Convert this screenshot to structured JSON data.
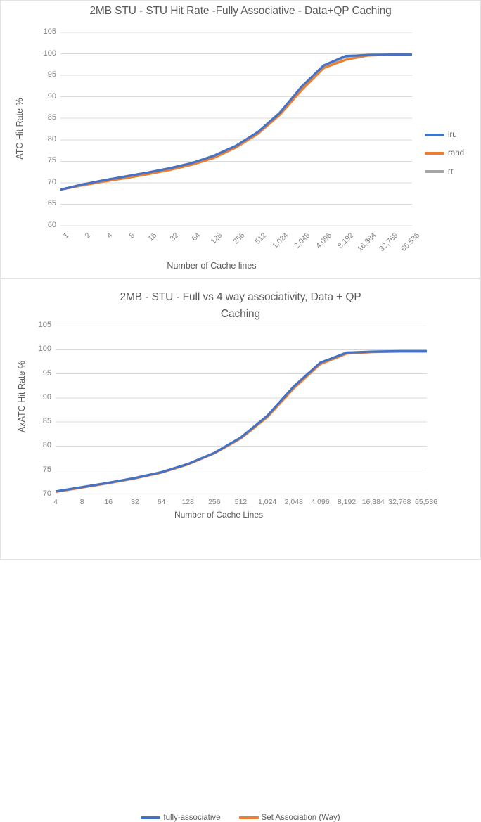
{
  "chart_data": [
    {
      "type": "line",
      "title": "2MB STU - STU Hit Rate -Fully Associative - Data+QP Caching",
      "xlabel": "Number of Cache lines",
      "ylabel": "ATC Hit Rate %",
      "ylim": [
        60,
        105
      ],
      "yticks": [
        60,
        65,
        70,
        75,
        80,
        85,
        90,
        95,
        100,
        105
      ],
      "grid": true,
      "legend_position": "right",
      "categories": [
        "1",
        "2",
        "4",
        "8",
        "16",
        "32",
        "64",
        "128",
        "256",
        "512",
        "1,024",
        "2,048",
        "4,096",
        "8,192",
        "16,384",
        "32,768",
        "65,536"
      ],
      "series": [
        {
          "name": "lru",
          "color": "#4472C4",
          "values": [
            68.4,
            69.6,
            70.6,
            71.5,
            72.4,
            73.4,
            74.6,
            76.3,
            78.6,
            81.8,
            86.3,
            92.4,
            97.3,
            99.5,
            99.7,
            99.8,
            99.8
          ]
        },
        {
          "name": "rand",
          "color": "#ED7D31",
          "values": [
            68.4,
            69.4,
            70.3,
            71.1,
            72.0,
            73.0,
            74.2,
            75.8,
            78.2,
            81.4,
            85.8,
            91.6,
            96.7,
            98.6,
            99.6,
            99.8,
            99.8
          ]
        },
        {
          "name": "rr",
          "color": "#A5A5A5",
          "values": [
            68.4,
            69.5,
            70.5,
            71.3,
            72.2,
            73.2,
            74.4,
            76.0,
            78.4,
            81.6,
            86.0,
            92.0,
            97.0,
            99.3,
            99.8,
            99.8,
            99.8
          ]
        }
      ]
    },
    {
      "type": "line",
      "title_line1": "2MB - STU - Full vs 4 way associativity, Data + QP",
      "title_line2": "Caching",
      "title": "2MB - STU - Full vs 4 way associativity, Data + QP Caching",
      "xlabel": "Number of Cache Lines",
      "ylabel": "AxATC Hit Rate %",
      "ylim": [
        70,
        105
      ],
      "yticks": [
        70,
        75,
        80,
        85,
        90,
        95,
        100,
        105
      ],
      "grid": true,
      "legend_position": "bottom",
      "categories": [
        "4",
        "8",
        "16",
        "32",
        "64",
        "128",
        "256",
        "512",
        "1,024",
        "2,048",
        "4,096",
        "8,192",
        "16,384",
        "32,768",
        "65,536"
      ],
      "series": [
        {
          "name": "fully-associative",
          "color": "#4472C4",
          "values": [
            70.6,
            71.5,
            72.4,
            73.4,
            74.6,
            76.3,
            78.6,
            81.8,
            86.3,
            92.4,
            97.3,
            99.4,
            99.6,
            99.7,
            99.7
          ]
        },
        {
          "name": "Set Association (Way)",
          "color": "#ED7D31",
          "values": [
            70.5,
            71.4,
            72.3,
            73.3,
            74.5,
            76.2,
            78.5,
            81.6,
            86.0,
            92.0,
            97.0,
            99.2,
            99.5,
            99.6,
            99.6
          ]
        }
      ]
    }
  ],
  "chart1": {
    "title": "2MB STU - STU Hit Rate -Fully Associative - Data+QP Caching",
    "ylabel": "ATC Hit Rate %",
    "xlabel": "Number of Cache lines",
    "legend": [
      {
        "label": "lru",
        "color": "#4472C4"
      },
      {
        "label": "rand",
        "color": "#ED7D31"
      },
      {
        "label": "rr",
        "color": "#A5A5A5"
      }
    ]
  },
  "chart2": {
    "title_line1": "2MB - STU - Full vs 4 way associativity, Data + QP",
    "title_line2": "Caching",
    "ylabel": "AxATC Hit Rate %",
    "xlabel": "Number of Cache Lines",
    "legend": [
      {
        "label": "fully-associative",
        "color": "#4472C4"
      },
      {
        "label": "Set Association (Way)",
        "color": "#ED7D31"
      }
    ]
  }
}
